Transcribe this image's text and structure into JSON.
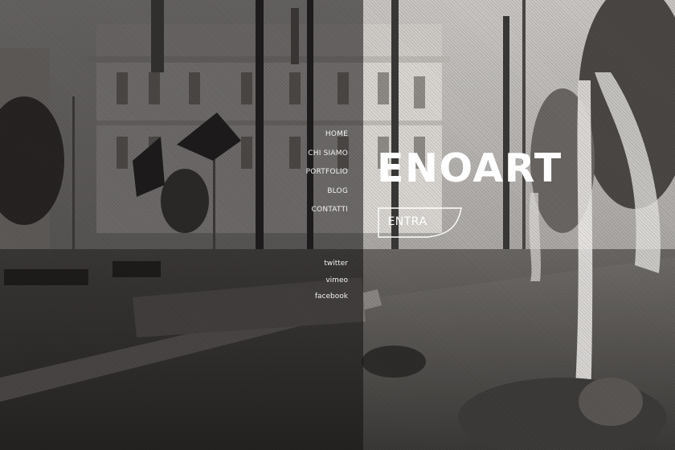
{
  "brand": {
    "title": "ENOART"
  },
  "nav": {
    "items": [
      {
        "label": "HOME"
      },
      {
        "label": "CHI SIAMO"
      },
      {
        "label": "PORTFOLIO"
      },
      {
        "label": "BLOG"
      },
      {
        "label": "CONTATTI"
      }
    ]
  },
  "social": {
    "items": [
      {
        "label": "twitter"
      },
      {
        "label": "vimeo"
      },
      {
        "label": "facebook"
      }
    ]
  },
  "cta": {
    "label": "ENTRA"
  },
  "colors": {
    "text": "#ffffff",
    "overlay": "#121110"
  }
}
